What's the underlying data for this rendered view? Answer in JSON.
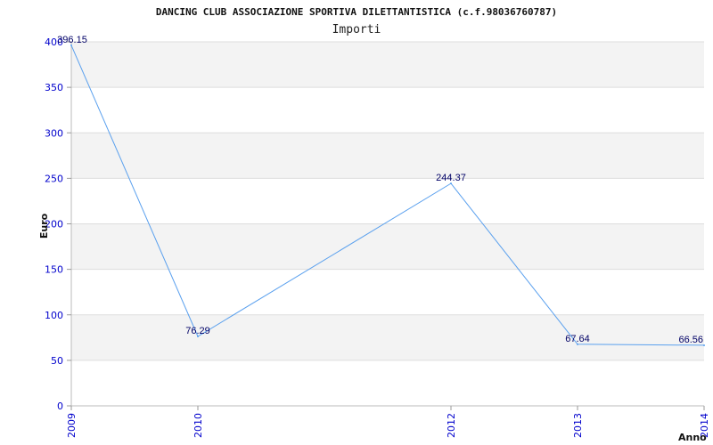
{
  "chart_data": {
    "type": "line",
    "title": "DANCING CLUB ASSOCIAZIONE SPORTIVA DILETTANTISTICA (c.f.98036760787)",
    "subtitle": "Importi",
    "xlabel": "Anno",
    "ylabel": "Euro",
    "ylim": [
      0,
      400
    ],
    "yticks": [
      "0",
      "50",
      "100",
      "150",
      "200",
      "250",
      "300",
      "350",
      "400"
    ],
    "x": [
      "2009",
      "2010",
      "2012",
      "2013",
      "2014"
    ],
    "x_numeric": [
      2009,
      2010,
      2012,
      2013,
      2014
    ],
    "values": [
      396.15,
      76.29,
      244.37,
      67.64,
      66.56
    ],
    "data_labels": [
      "396.15",
      "76.29",
      "244.37",
      "67.64",
      "66.56"
    ],
    "grid": true,
    "colors": {
      "line": "#5aa0ee",
      "tick_text": "#0000cc",
      "data_label": "#000066",
      "band": "#f3f3f3",
      "grid": "#dddddd"
    }
  }
}
